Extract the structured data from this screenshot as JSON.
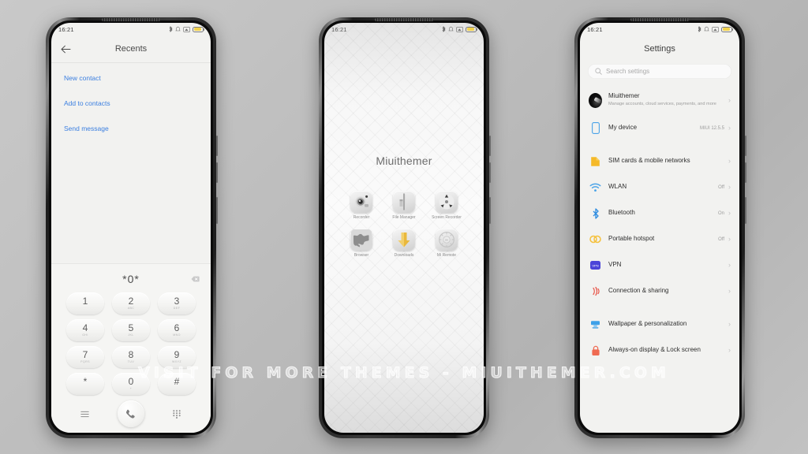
{
  "watermark": "VISIT FOR MORE THEMES - MIUITHEMER.COM",
  "status_bar": {
    "time": "16:21"
  },
  "phone_dialer": {
    "title": "Recents",
    "back_icon": "back-arrow-icon",
    "links": [
      {
        "label": "New contact"
      },
      {
        "label": "Add to contacts"
      },
      {
        "label": "Send message"
      }
    ],
    "dialed_number": "*0*",
    "backspace_icon": "backspace-icon",
    "keys": [
      {
        "num": "1",
        "sub": ""
      },
      {
        "num": "2",
        "sub": "ABC"
      },
      {
        "num": "3",
        "sub": "DEF"
      },
      {
        "num": "4",
        "sub": "GHI"
      },
      {
        "num": "5",
        "sub": "JKL"
      },
      {
        "num": "6",
        "sub": "MNO"
      },
      {
        "num": "7",
        "sub": "PQRS"
      },
      {
        "num": "8",
        "sub": "TUV"
      },
      {
        "num": "9",
        "sub": "WXYZ"
      },
      {
        "num": "*",
        "sub": ""
      },
      {
        "num": "0",
        "sub": "+"
      },
      {
        "num": "#",
        "sub": ""
      }
    ],
    "bottom_bar": {
      "menu_icon": "hamburger-menu-icon",
      "call_icon": "phone-call-icon",
      "keypad_icon": "keypad-grid-icon"
    }
  },
  "phone_home": {
    "widget_title": "Miuithemer",
    "apps": [
      {
        "label": "Recorder",
        "icon": "recorder-icon"
      },
      {
        "label": "File Manager",
        "icon": "file-manager-icon"
      },
      {
        "label": "Screen Recorder",
        "icon": "screen-recorder-icon"
      },
      {
        "label": "Browser",
        "icon": "browser-globe-icon"
      },
      {
        "label": "Downloads",
        "icon": "downloads-arrow-icon"
      },
      {
        "label": "Mi Remote",
        "icon": "mi-remote-icon"
      }
    ]
  },
  "phone_settings": {
    "title": "Settings",
    "search": {
      "placeholder": "Search settings",
      "icon": "search-icon"
    },
    "groups": [
      {
        "rows": [
          {
            "label": "Miuithemer",
            "sub": "Manage accounts, cloud services, payments, and more",
            "value": "",
            "icon": "account-avatar",
            "color": "#111111"
          }
        ]
      },
      {
        "rows": [
          {
            "label": "My device",
            "sub": "",
            "value": "MIUI 12.5.5",
            "icon": "device-icon",
            "color": "#4aa3e8"
          }
        ]
      },
      {
        "rows": [
          {
            "label": "SIM cards & mobile networks",
            "sub": "",
            "value": "",
            "icon": "sim-card-icon",
            "color": "#f5b928"
          },
          {
            "label": "WLAN",
            "sub": "",
            "value": "Off",
            "icon": "wifi-icon",
            "color": "#4aa3e8"
          },
          {
            "label": "Bluetooth",
            "sub": "",
            "value": "On",
            "icon": "bluetooth-icon",
            "color": "#2e8ce0"
          },
          {
            "label": "Portable hotspot",
            "sub": "",
            "value": "Off",
            "icon": "hotspot-icon",
            "color": "#f5c03a"
          },
          {
            "label": "VPN",
            "sub": "",
            "value": "",
            "icon": "vpn-icon",
            "color": "#4b45d8"
          },
          {
            "label": "Connection & sharing",
            "sub": "",
            "value": "",
            "icon": "connection-sharing-icon",
            "color": "#e8574b"
          }
        ]
      },
      {
        "rows": [
          {
            "label": "Wallpaper & personalization",
            "sub": "",
            "value": "",
            "icon": "wallpaper-icon",
            "color": "#3ea0e8"
          },
          {
            "label": "Always-on display & Lock screen",
            "sub": "",
            "value": "",
            "icon": "lock-icon",
            "color": "#ef6a52"
          }
        ]
      }
    ]
  }
}
